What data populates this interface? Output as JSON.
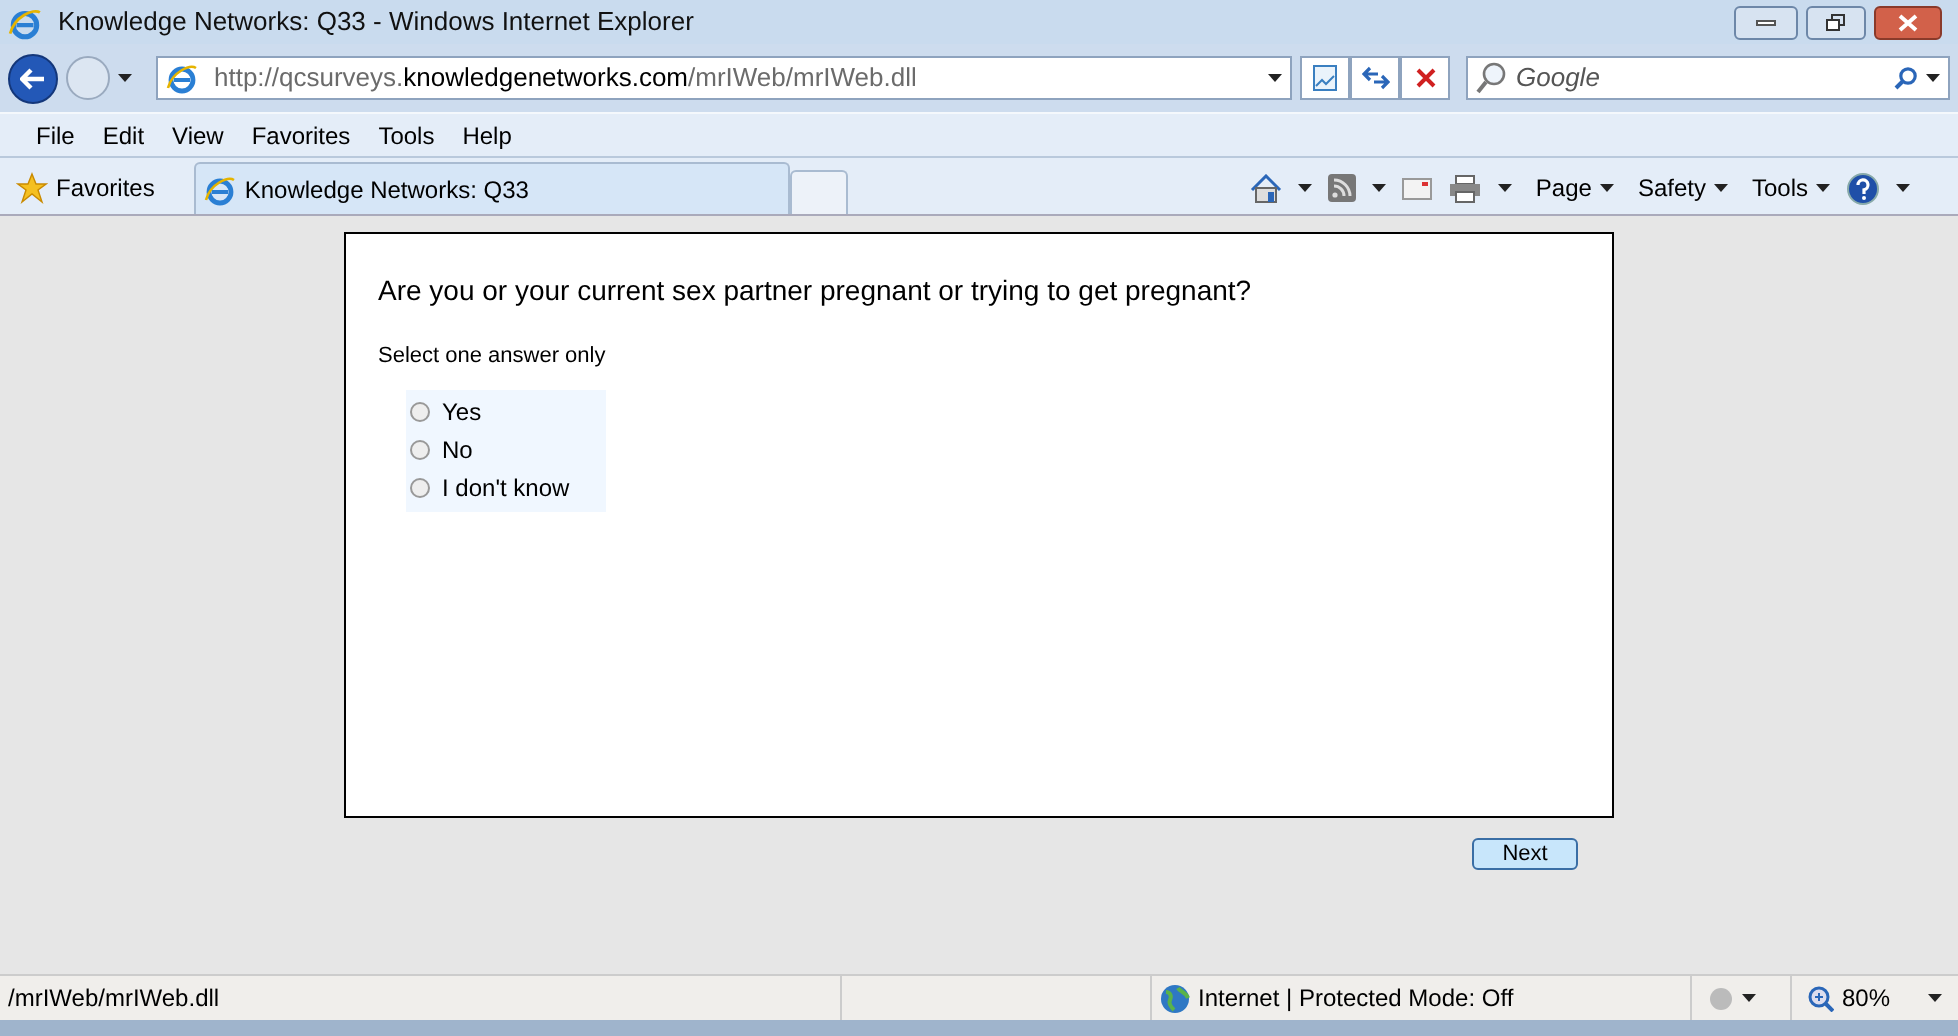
{
  "window": {
    "title": "Knowledge Networks: Q33 - Windows Internet Explorer"
  },
  "address": {
    "prefix": "http://qcsurveys.",
    "domain": "knowledgenetworks.com",
    "path": "/mrIWeb/mrIWeb.dll"
  },
  "search": {
    "placeholder": "Google"
  },
  "menu": [
    "File",
    "Edit",
    "View",
    "Favorites",
    "Tools",
    "Help"
  ],
  "favorites": {
    "label": "Favorites",
    "tab": "Knowledge Networks: Q33"
  },
  "command_bar": [
    "Page",
    "Safety",
    "Tools"
  ],
  "survey": {
    "question": "Are you or your current sex partner pregnant or trying to get pregnant?",
    "instruction": "Select one answer only",
    "options": [
      {
        "label": "Yes",
        "selected": false
      },
      {
        "label": "No",
        "selected": false
      },
      {
        "label": "I don't know",
        "selected": false
      }
    ],
    "next": "Next"
  },
  "status_bar": {
    "text": "/mrIWeb/mrIWeb.dll",
    "zone": "Internet | Protected Mode: Off",
    "zoom": "80%"
  }
}
